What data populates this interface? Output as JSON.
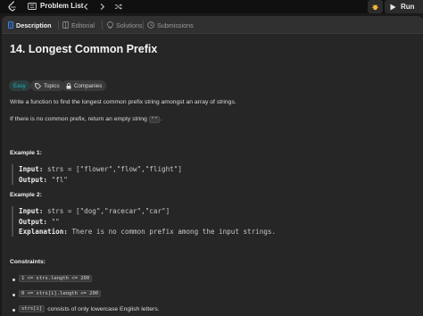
{
  "topbar": {
    "problem_list_label": "Problem List",
    "run_label": "Run",
    "run_color": "#e8e8e8",
    "debug_color": "#f5b83d"
  },
  "tabs": [
    {
      "label": "Description",
      "icon": "description-icon",
      "active": true,
      "color": "#3b82f6"
    },
    {
      "label": "Editorial",
      "icon": "editorial-icon",
      "active": false
    },
    {
      "label": "Solutions",
      "icon": "solutions-icon",
      "active": false
    },
    {
      "label": "Submissions",
      "icon": "submissions-icon",
      "active": false
    }
  ],
  "problem": {
    "title": "14. Longest Common Prefix",
    "difficulty": "Easy",
    "difficulty_color": "#1cb8b8",
    "topics_label": "Topics",
    "companies_label": "Companies",
    "description_1": "Write a function to find the longest common prefix string amongst an array of strings.",
    "description_2_pre": "If there is no common prefix, return an empty string",
    "description_2_code": "\"\"",
    "description_2_post": "."
  },
  "examples": [
    {
      "heading": "Example 1:",
      "input_label": "Input:",
      "input_value": "strs = [\"flower\",\"flow\",\"flight\"]",
      "output_label": "Output:",
      "output_value": "\"fl\""
    },
    {
      "heading": "Example 2:",
      "input_label": "Input:",
      "input_value": "strs = [\"dog\",\"racecar\",\"car\"]",
      "output_label": "Output:",
      "output_value": "\"\"",
      "explanation_label": "Explanation:",
      "explanation_value": "There is no common prefix among the input strings."
    }
  ],
  "constraints": {
    "heading": "Constraints:",
    "items": [
      {
        "code": "1 <= strs.length <= 200",
        "text": ""
      },
      {
        "code": "0 <= strs[i].length <= 200",
        "text": ""
      },
      {
        "code": "strs[i]",
        "text": "consists of only lowercase English letters."
      }
    ]
  }
}
